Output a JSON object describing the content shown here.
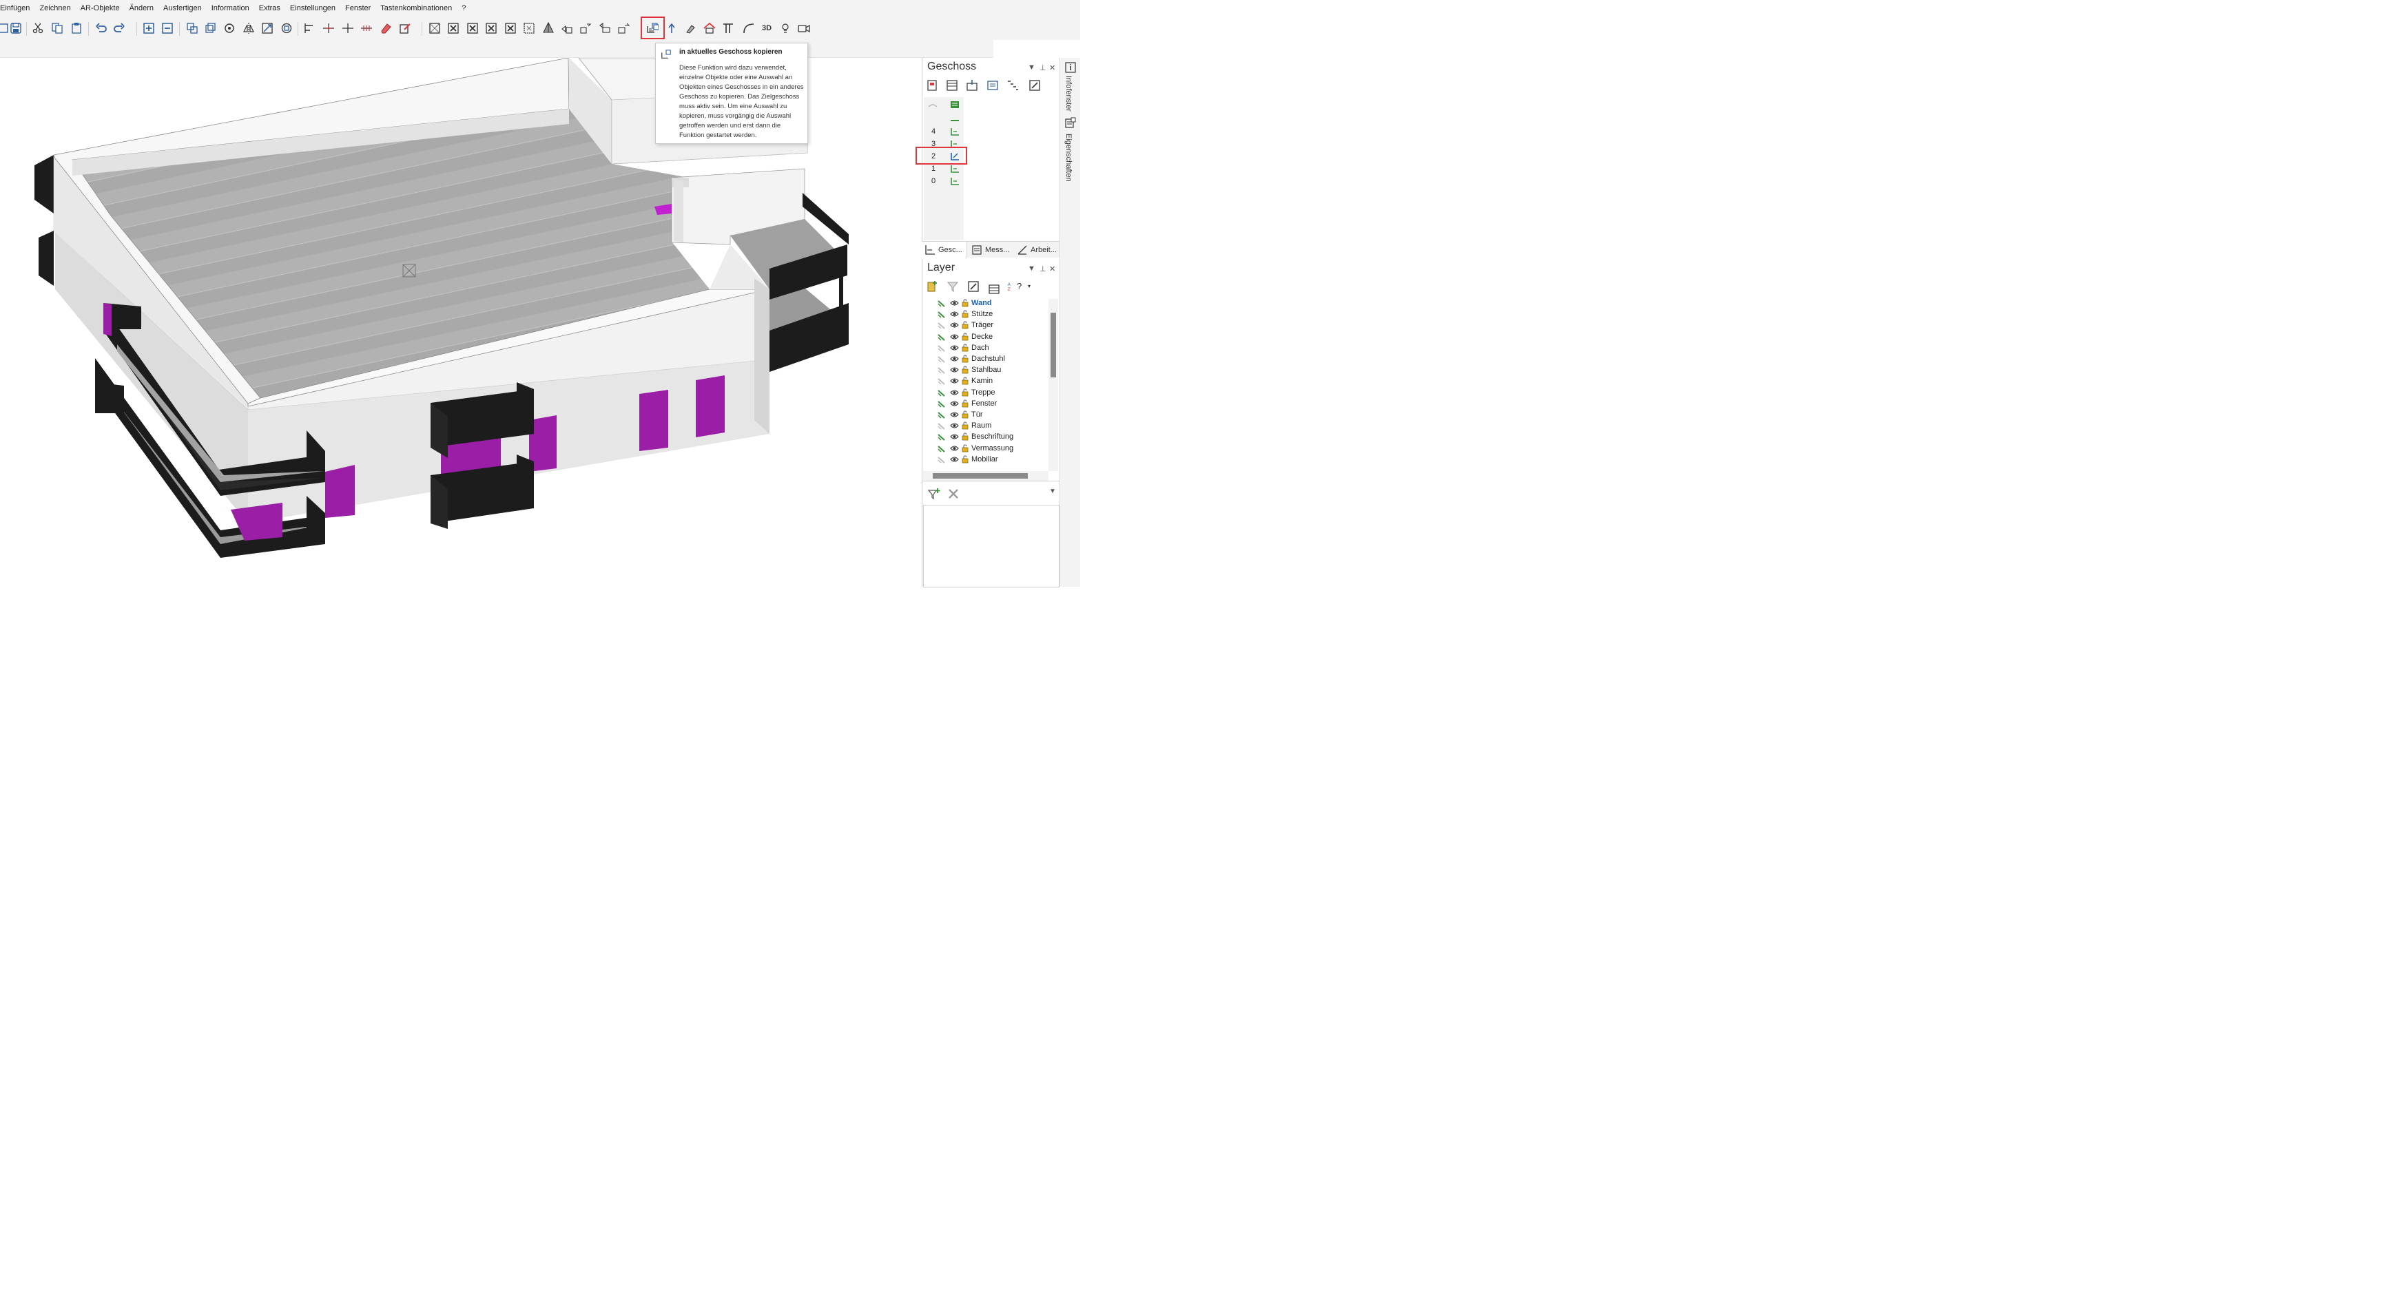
{
  "menu": [
    "Einfügen",
    "Zeichnen",
    "AR-Objekte",
    "Ändern",
    "Ausfertigen",
    "Information",
    "Extras",
    "Einstellungen",
    "Fenster",
    "Tastenkombinationen",
    "?"
  ],
  "toolbar": {
    "label_3d": "3D",
    "icons": [
      "cut-icon",
      "copy-icon",
      "paste-icon",
      "undo-icon",
      "redo-icon",
      "zoom-in-icon",
      "zoom-out-icon",
      "copy-objects-icon",
      "duplicate-icon",
      "rotate-icon",
      "mirror-icon",
      "scale-icon",
      "transform-icon",
      "align-icon",
      "dimension-icon",
      "split-icon",
      "measure-icon",
      "erase-icon",
      "edit-icon",
      "view-front-icon",
      "view-back-icon",
      "view-left-icon",
      "view-right-icon",
      "view-top-icon",
      "view-bottom-icon",
      "perspective-icon",
      "move-floor-icon",
      "copy-floor-icon",
      "new-object-icon",
      "move-object-icon",
      "copy-to-floor-icon",
      "upload-floor-icon",
      "paint-icon",
      "roof-icon",
      "column-icon",
      "curve-icon",
      "view-3d-icon",
      "light-icon",
      "camera-icon"
    ]
  },
  "tooltip": {
    "title": "in aktuelles Geschoss kopieren",
    "body": "Diese Funktion wird dazu verwendet, einzelne Objekte oder eine Auswahl an Objekten eines Geschosses in ein anderes Geschoss zu kopieren. Das Zielgeschoss muss aktiv sein. Um eine Auswahl zu kopieren, muss vorgängig die Auswahl getroffen werden und erst dann die Funktion gestartet werden."
  },
  "geschoss": {
    "title": "Geschoss",
    "floors": [
      "4",
      "3",
      "2",
      "1",
      "0"
    ],
    "active_floor": "2",
    "tabs": [
      "Gesc...",
      "Mess...",
      "Arbeit..."
    ]
  },
  "layer": {
    "title": "Layer",
    "sort_label": "?",
    "active": "Wand",
    "items": [
      {
        "name": "Wand",
        "active": true
      },
      {
        "name": "Stütze"
      },
      {
        "name": "Träger"
      },
      {
        "name": "Decke"
      },
      {
        "name": "Dach"
      },
      {
        "name": "Dachstuhl"
      },
      {
        "name": "Stahlbau"
      },
      {
        "name": "Kamin"
      },
      {
        "name": "Treppe"
      },
      {
        "name": "Fenster"
      },
      {
        "name": "Tür"
      },
      {
        "name": "Raum"
      },
      {
        "name": "Beschriftung"
      },
      {
        "name": "Vermassung"
      },
      {
        "name": "Mobiliar"
      }
    ]
  },
  "side_tabs": [
    "Infofenster",
    "Eigenschaften"
  ],
  "colors": {
    "highlight": "#e0363b",
    "accent": "#1a5fb4",
    "icon_green": "#3a8f3a",
    "wall": "#efefef",
    "floor": "#a5a5a5",
    "window": "#a020a8",
    "railing": "#1c1c1c"
  }
}
